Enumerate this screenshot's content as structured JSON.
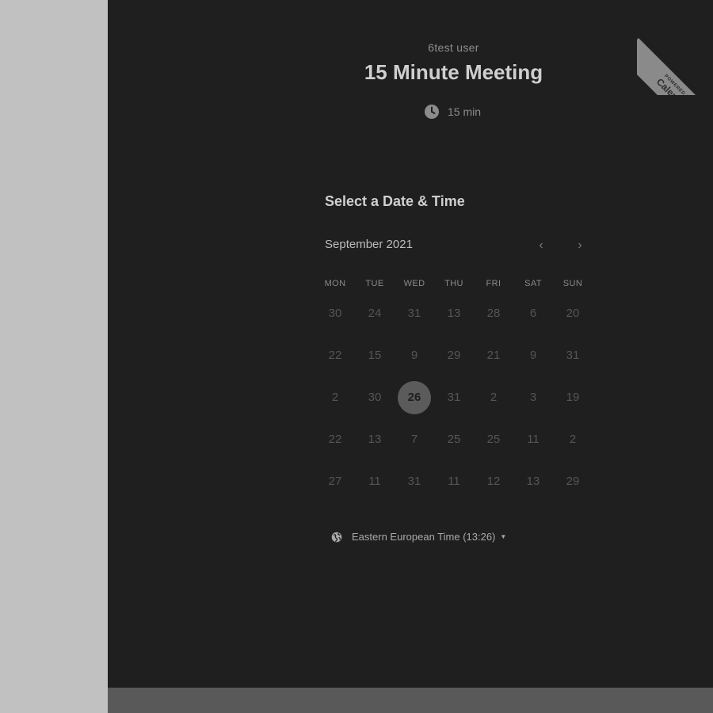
{
  "event": {
    "host": "6test user",
    "title": "15 Minute Meeting",
    "duration": "15 min"
  },
  "ribbon": {
    "small": "POWERED BY",
    "brand": "Calendly"
  },
  "calendar": {
    "heading": "Select a Date & Time",
    "month_label": "September 2021",
    "weekdays": [
      "MON",
      "TUE",
      "WED",
      "THU",
      "FRI",
      "SAT",
      "SUN"
    ],
    "weeks": [
      [
        "30",
        "24",
        "31",
        "13",
        "28",
        "6",
        "20"
      ],
      [
        "22",
        "15",
        "9",
        "29",
        "21",
        "9",
        "31"
      ],
      [
        "2",
        "30",
        "26",
        "31",
        "2",
        "3",
        "19"
      ],
      [
        "22",
        "13",
        "7",
        "25",
        "25",
        "11",
        "2"
      ],
      [
        "27",
        "11",
        "31",
        "11",
        "12",
        "13",
        "29"
      ]
    ],
    "available_day": "26"
  },
  "timezone": {
    "label": "Eastern European Time (13:26)"
  },
  "colors": {
    "panel": "#1f1f1f",
    "page": "#c0c0c0",
    "footer": "#595959"
  }
}
